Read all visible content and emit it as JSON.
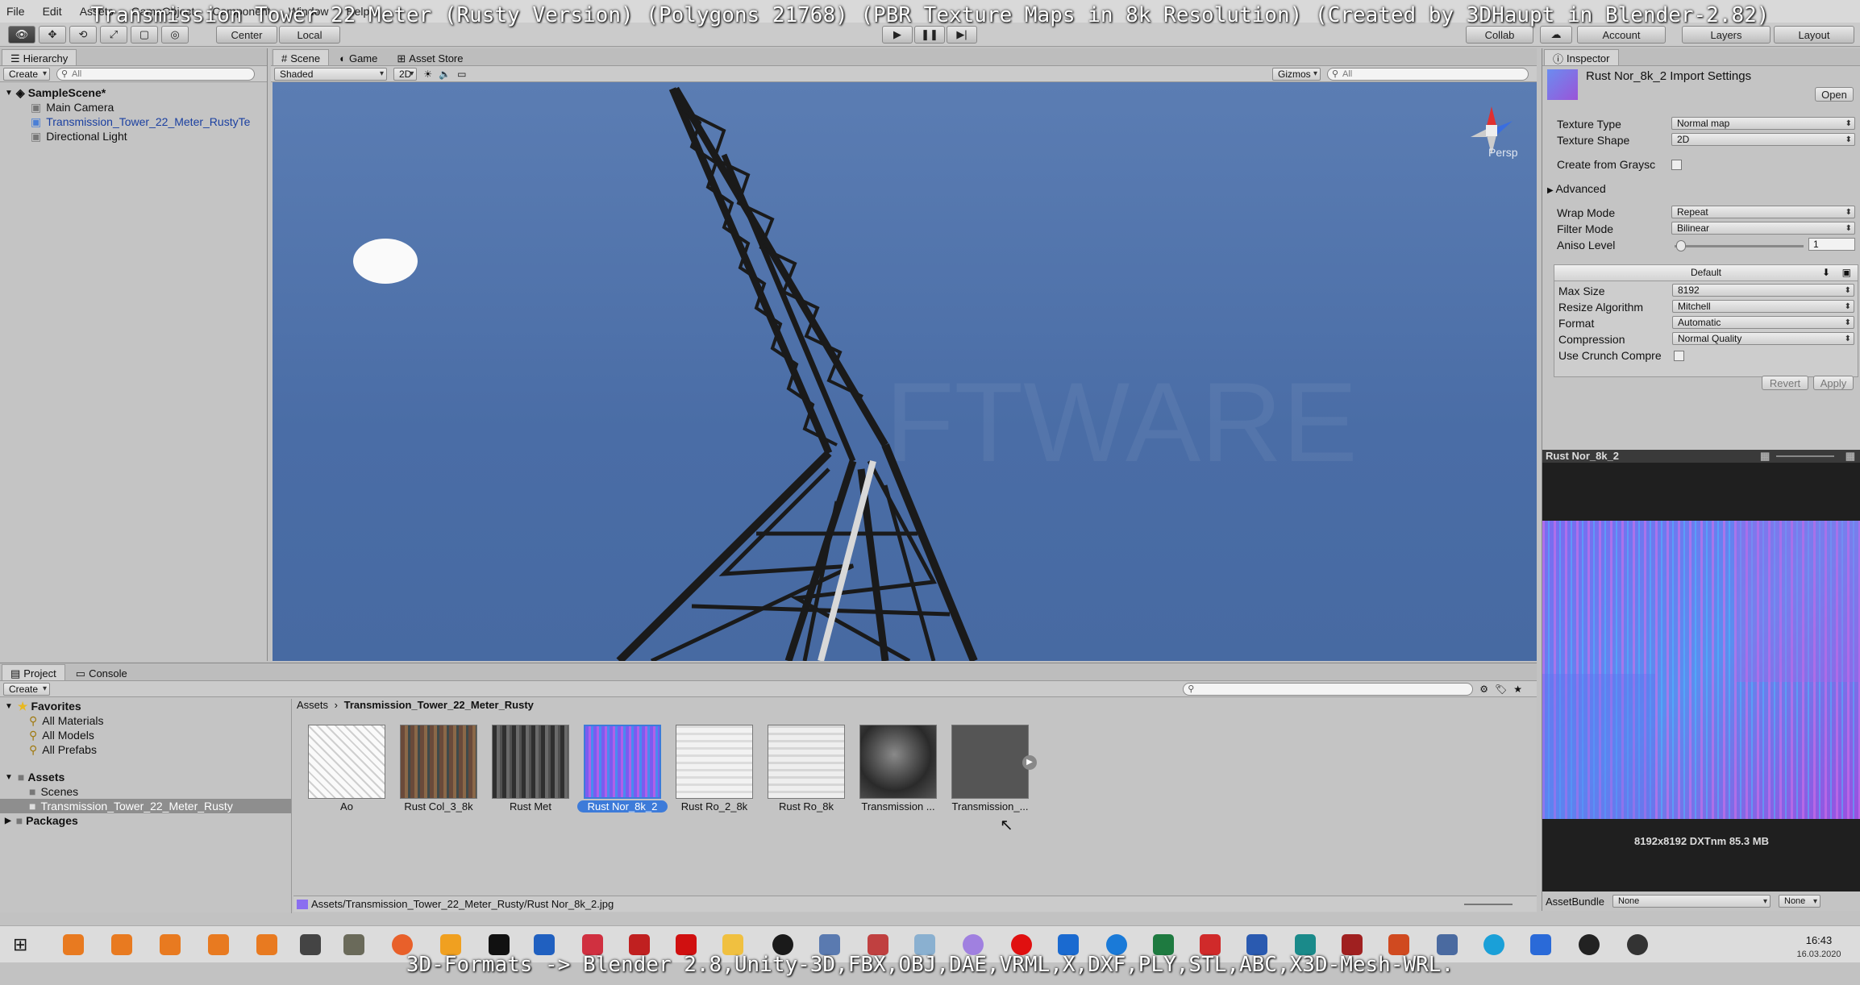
{
  "overlay": {
    "title": "Transmission Tower 22 Meter (Rusty Version) (Polygons 21768) (PBR Texture Maps in 8k Resolution) (Created by 3DHaupt in Blender-2.82)",
    "bottom_caption": "3D-Formats -> Blender 2.8,Unity-3D,FBX,OBJ,DAE,VRML,X,DXF,PLY,STL,ABC,X3D-Mesh-WRL."
  },
  "menu": [
    "File",
    "Edit",
    "Assets",
    "GameObject",
    "Component",
    "Window",
    "Help"
  ],
  "toolbar": {
    "center": "Center",
    "local": "Local",
    "collab": "Collab",
    "account": "Account",
    "layers": "Layers",
    "layout": "Layout"
  },
  "hierarchy": {
    "tab": "Hierarchy",
    "create": "Create",
    "search_placeholder": "All",
    "scene_name": "SampleScene*",
    "items": [
      "Main Camera",
      "Transmission_Tower_22_Meter_RustyTe",
      "Directional Light"
    ]
  },
  "scene": {
    "tabs": [
      "Scene",
      "Game",
      "Asset Store"
    ],
    "shading": "Shaded",
    "mode_2d": "2D",
    "gizmos": "Gizmos",
    "search_placeholder": "All",
    "persp": "Persp",
    "watermark": "FTWARE"
  },
  "inspector": {
    "tab": "Inspector",
    "title": "Rust Nor_8k_2 Import Settings",
    "open": "Open",
    "texture_type_label": "Texture Type",
    "texture_type": "Normal map",
    "texture_shape_label": "Texture Shape",
    "texture_shape": "2D",
    "create_from_grayscale": "Create from Graysc",
    "advanced": "Advanced",
    "wrap_mode_label": "Wrap Mode",
    "wrap_mode": "Repeat",
    "filter_mode_label": "Filter Mode",
    "filter_mode": "Bilinear",
    "aniso_label": "Aniso Level",
    "aniso_value": "1",
    "platform": "Default",
    "max_size_label": "Max Size",
    "max_size": "8192",
    "resize_label": "Resize Algorithm",
    "resize": "Mitchell",
    "format_label": "Format",
    "format": "Automatic",
    "compression_label": "Compression",
    "compression": "Normal Quality",
    "crunch_label": "Use Crunch Compre",
    "revert": "Revert",
    "apply": "Apply"
  },
  "preview": {
    "title": "Rust Nor_8k_2",
    "info": "8192x8192  DXTnm   85.3 MB",
    "assetbundle_label": "AssetBundle",
    "assetbundle_value": "None",
    "variant_value": "None"
  },
  "project": {
    "tabs": [
      "Project",
      "Console"
    ],
    "create": "Create",
    "breadcrumb_root": "Assets",
    "breadcrumb_folder": "Transmission_Tower_22_Meter_Rusty",
    "favorites": "Favorites",
    "fav_items": [
      "All Materials",
      "All Models",
      "All Prefabs"
    ],
    "assets": "Assets",
    "asset_folders": [
      "Scenes",
      "Transmission_Tower_22_Meter_Rusty"
    ],
    "packages": "Packages",
    "thumbnails": [
      "Ao",
      "Rust Col_3_8k",
      "Rust Met",
      "Rust Nor_8k_2",
      "Rust Ro_2_8k",
      "Rust Ro_8k",
      "Transmission ...",
      "Transmission_..."
    ],
    "status_path": "Assets/Transmission_Tower_22_Meter_Rusty/Rust Nor_8k_2.jpg"
  },
  "taskbar": {
    "time": "16:43",
    "date": "16.03.2020"
  },
  "colors": {
    "sky": "#4f73ab",
    "selection": "#3d7bd9",
    "normal_map_purple": "#8a4fe0"
  }
}
